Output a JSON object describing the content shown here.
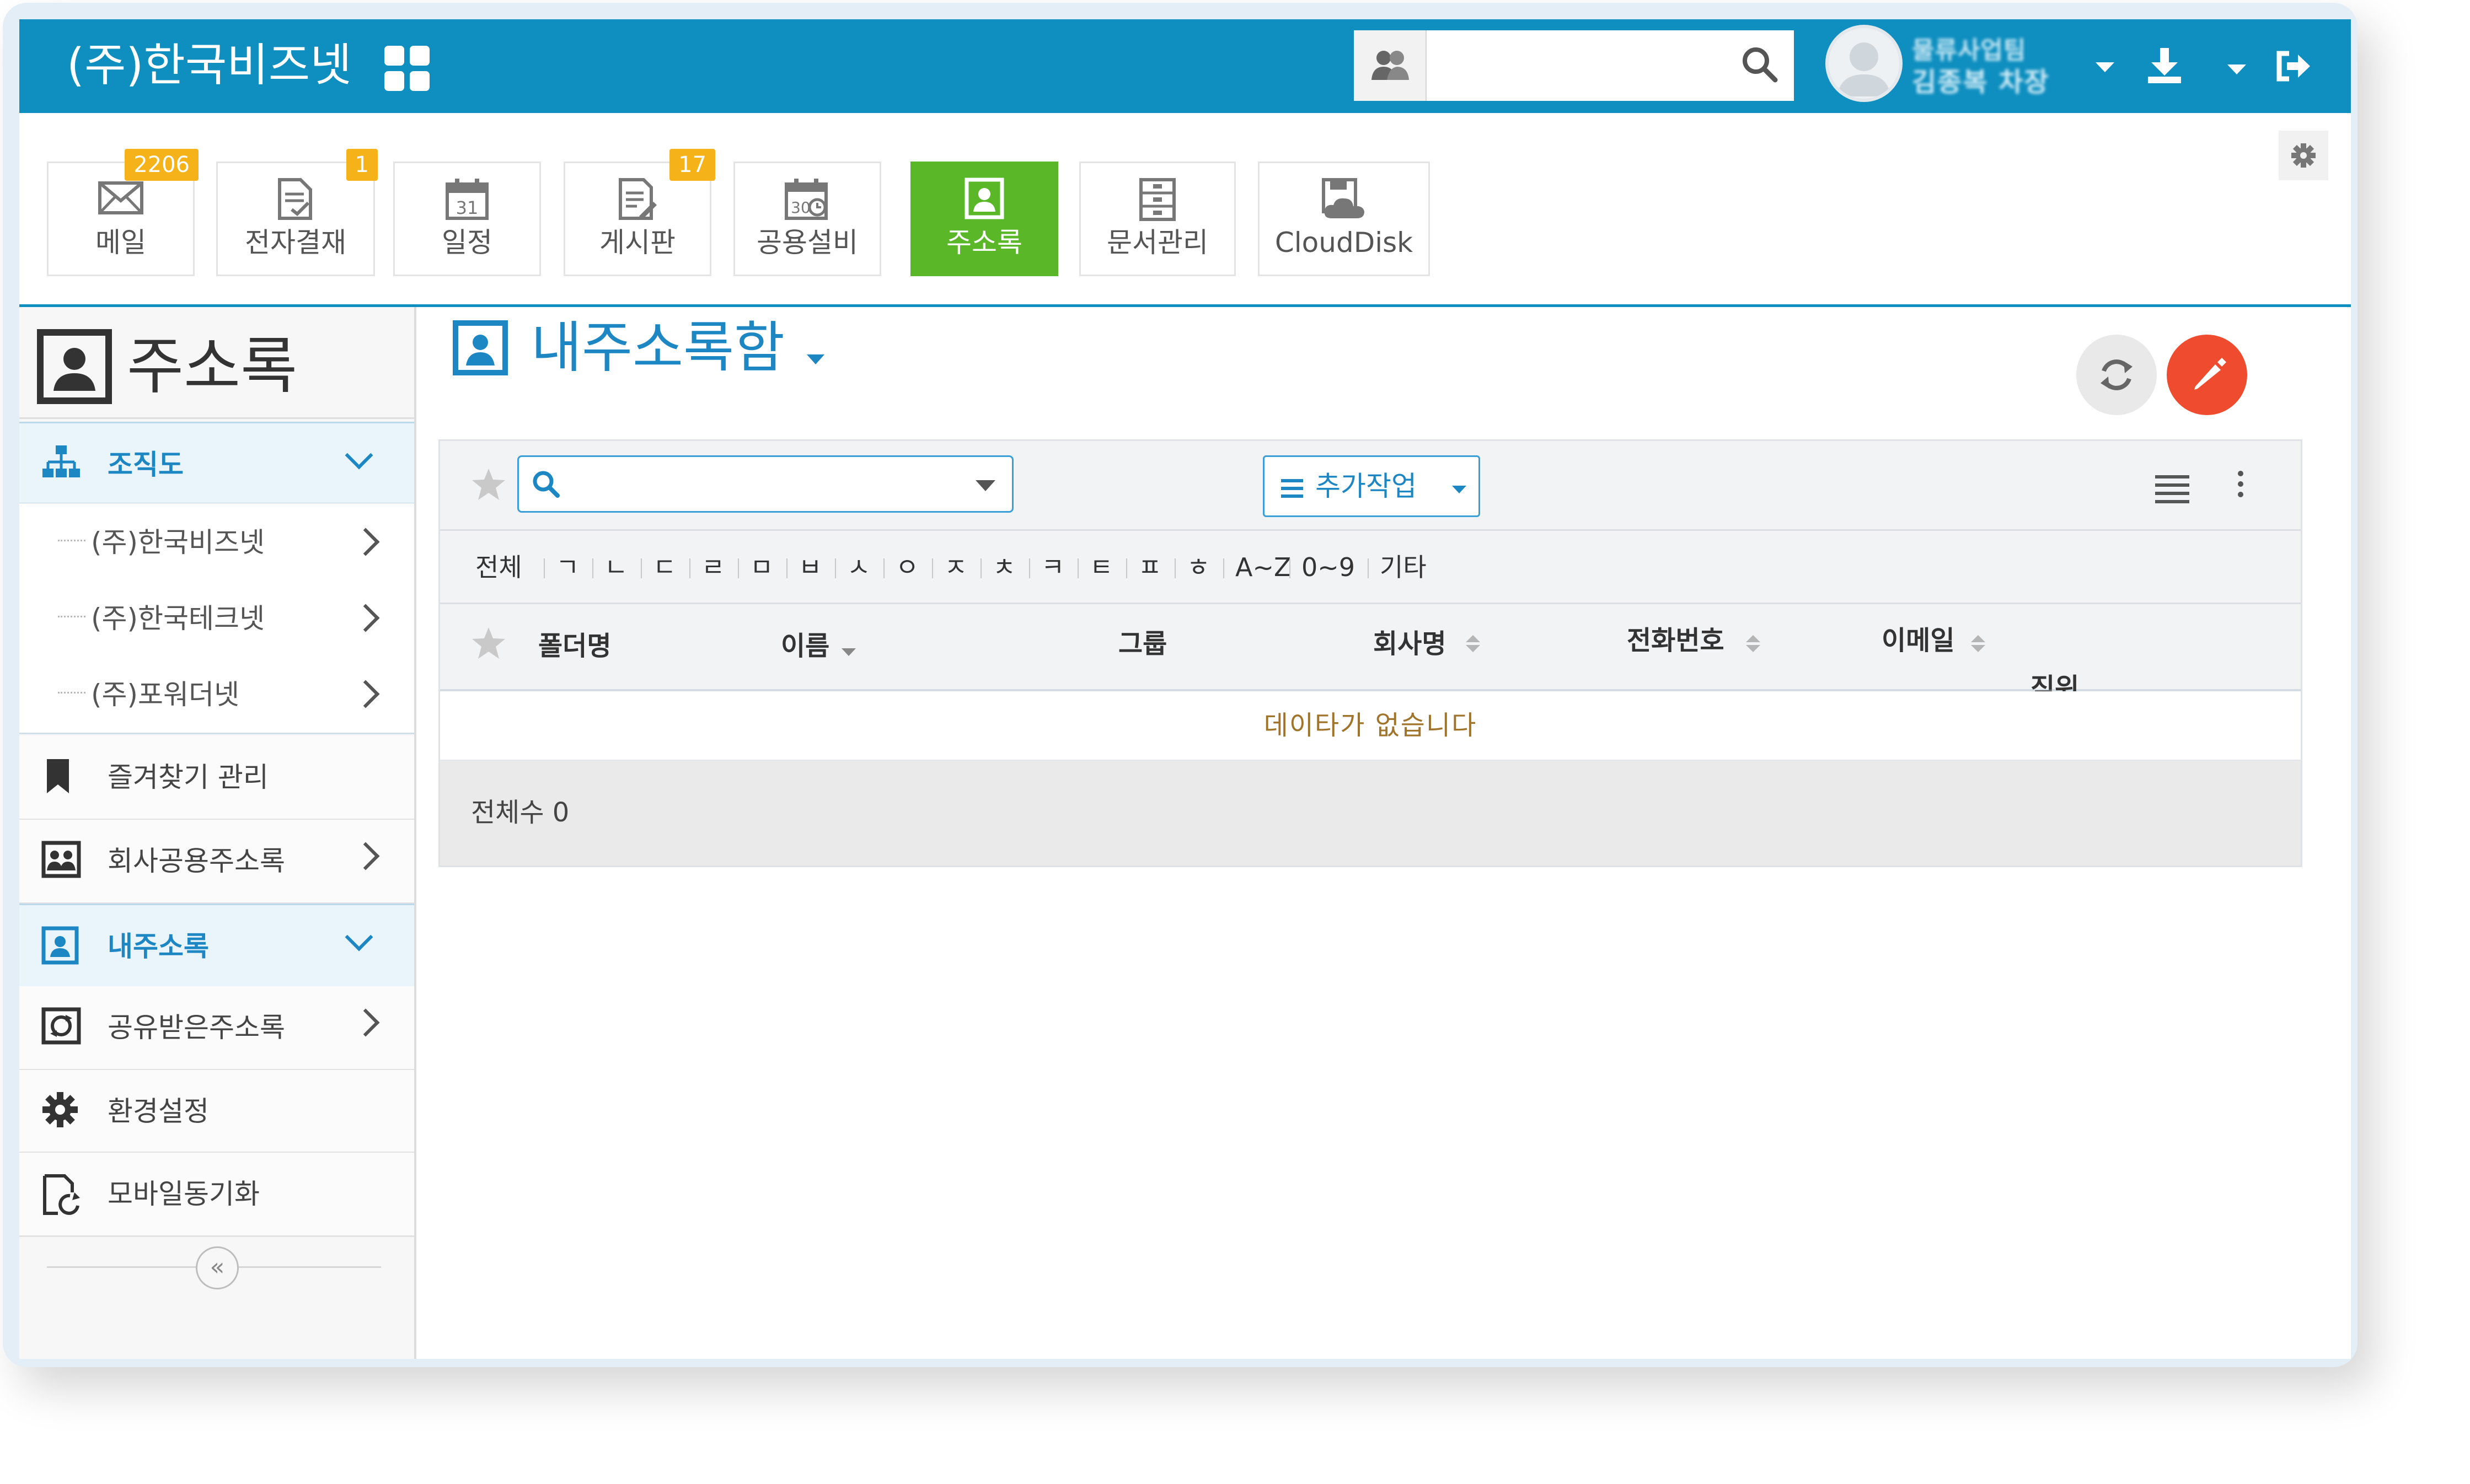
{
  "header": {
    "brand": "(주)한국비즈넷",
    "search": {
      "value": "",
      "placeholder": ""
    },
    "user": {
      "dept": "물류사업팀",
      "name": "김종복 차장"
    },
    "accent": "#0e8fc0"
  },
  "apps": [
    {
      "label": "메일",
      "badge": "2206",
      "icon": "mail-icon"
    },
    {
      "label": "전자결재",
      "badge": "1",
      "icon": "approval-icon"
    },
    {
      "label": "일정",
      "badge": "",
      "icon": "calendar-icon",
      "icon_text": "31"
    },
    {
      "label": "게시판",
      "badge": "17",
      "icon": "board-icon"
    },
    {
      "label": "공용설비",
      "badge": "",
      "icon": "facility-icon",
      "icon_text": "30"
    },
    {
      "label": "주소록",
      "badge": "",
      "icon": "addressbook-icon",
      "active": true
    },
    {
      "label": "문서관리",
      "badge": "",
      "icon": "document-icon"
    },
    {
      "label": "CloudDisk",
      "badge": "",
      "icon": "clouddisk-icon"
    }
  ],
  "sidebar": {
    "title": "주소록",
    "org": {
      "label": "조직도",
      "children": [
        "(주)한국비즈넷",
        "(주)한국테크넷",
        "(주)포워더넷"
      ]
    },
    "favorites": "즐겨찾기 관리",
    "company_shared": "회사공용주소록",
    "my_address": "내주소록",
    "shared_received": "공유받은주소록",
    "settings": "환경설정",
    "mobile_sync": "모바일동기화",
    "collapse_glyph": "«"
  },
  "main": {
    "title": "내주소록함",
    "search": {
      "value": "",
      "placeholder": ""
    },
    "more_actions": "추가작업",
    "alpha_filters": [
      "전체",
      "ㄱ",
      "ㄴ",
      "ㄷ",
      "ㄹ",
      "ㅁ",
      "ㅂ",
      "ㅅ",
      "ㅇ",
      "ㅈ",
      "ㅊ",
      "ㅋ",
      "ㅌ",
      "ㅍ",
      "ㅎ",
      "A~Z",
      "0~9",
      "기타"
    ],
    "columns": {
      "folder": "폴더명",
      "name": "이름",
      "group": "그룹",
      "company": "회사명",
      "phone": "전화번호",
      "email": "이메일",
      "position": "직위"
    },
    "empty_message": "데이타가 없습니다",
    "total_label": "전체수 0"
  },
  "colors": {
    "active_tile": "#5ab828",
    "badge": "#f5b219",
    "link_blue": "#1d87c4",
    "compose": "#ef4b2f"
  }
}
